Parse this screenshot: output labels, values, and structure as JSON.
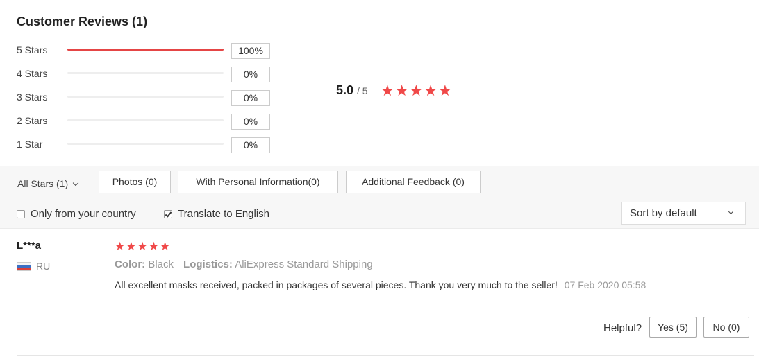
{
  "title": "Customer Reviews (1)",
  "distribution": [
    {
      "label": "5 Stars",
      "fraction": 1.0,
      "percent": "100%"
    },
    {
      "label": "4 Stars",
      "fraction": 0.0,
      "percent": "0%"
    },
    {
      "label": "3 Stars",
      "fraction": 0.0,
      "percent": "0%"
    },
    {
      "label": "2 Stars",
      "fraction": 0.0,
      "percent": "0%"
    },
    {
      "label": "1 Star",
      "fraction": 0.0,
      "percent": "0%"
    }
  ],
  "summary": {
    "score": "5.0",
    "max": "/ 5",
    "stars": 5
  },
  "filters": {
    "all_stars": "All Stars (1)",
    "photos": "Photos (0)",
    "personal_info": "With Personal Information(0)",
    "additional_feedback": "Additional Feedback (0)",
    "only_country": "Only from your country",
    "only_country_checked": false,
    "translate": "Translate to English",
    "translate_checked": true,
    "sort": "Sort by default"
  },
  "review": {
    "author": "L***a",
    "country": "RU",
    "stars": 5,
    "color_label": "Color:",
    "color_value": "Black",
    "logistics_label": "Logistics:",
    "logistics_value": "AliExpress Standard Shipping",
    "text": "All excellent masks received, packed in packages of several pieces. Thank you very much to the seller!",
    "date": "07 Feb 2020 05:58",
    "helpful_label": "Helpful?",
    "yes": "Yes (5)",
    "no": "No (0)"
  },
  "colors": {
    "accent": "#f04848",
    "bar_fill": "#e54545"
  },
  "icons": {
    "star": "star-icon",
    "flag": "russia-flag-icon",
    "dropdown": "chevron-down-icon"
  }
}
